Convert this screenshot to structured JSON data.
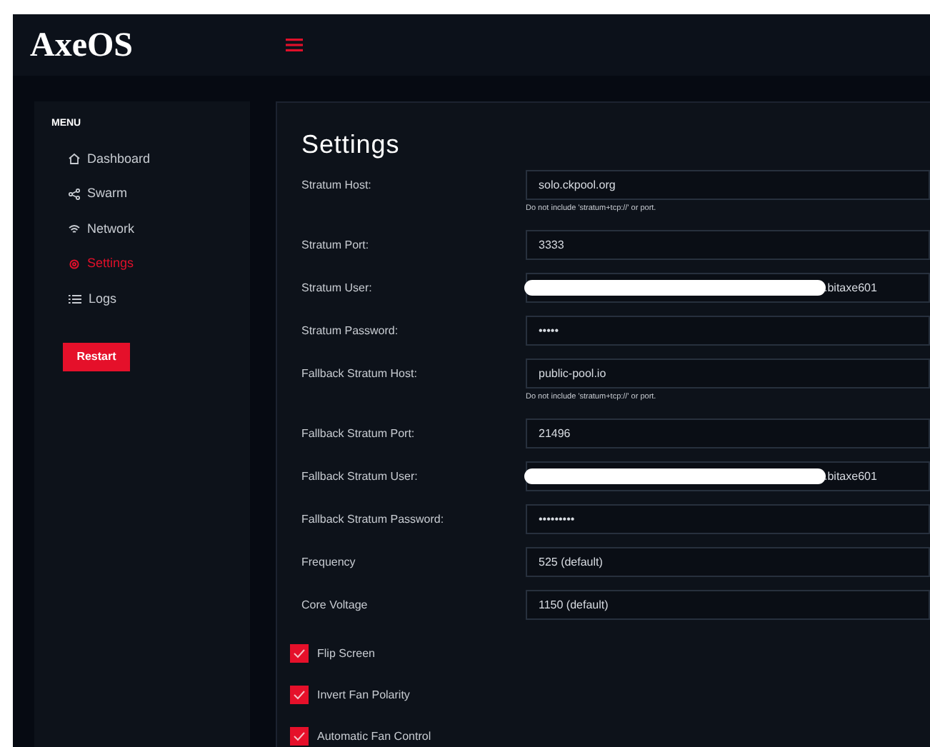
{
  "header": {
    "logo": "AxeOS"
  },
  "sidebar": {
    "heading": "MENU",
    "items": [
      {
        "label": "Dashboard",
        "selected": false
      },
      {
        "label": "Swarm",
        "selected": false
      },
      {
        "label": "Network",
        "selected": false
      },
      {
        "label": "Settings",
        "selected": true
      },
      {
        "label": "Logs",
        "selected": false
      }
    ],
    "restart_button": "Restart"
  },
  "settings": {
    "title": "Settings",
    "fields": [
      {
        "label": "Stratum Host:",
        "value": "solo.ckpool.org",
        "hint": "Do not include 'stratum+tcp://' or port.",
        "redacted": false
      },
      {
        "label": "Stratum Port:",
        "value": "3333",
        "redacted": false
      },
      {
        "label": "Stratum User:",
        "value": ".bitaxe601",
        "redacted": true
      },
      {
        "label": "Stratum Password:",
        "value": "•••••",
        "redacted": false
      },
      {
        "label": "Fallback Stratum Host:",
        "value": "public-pool.io",
        "hint": "Do not include 'stratum+tcp://' or port.",
        "redacted": false
      },
      {
        "label": "Fallback Stratum Port:",
        "value": "21496",
        "redacted": false
      },
      {
        "label": "Fallback Stratum User:",
        "value": ".bitaxe601",
        "redacted": true
      },
      {
        "label": "Fallback Stratum Password:",
        "value": "•••••••••",
        "redacted": false
      },
      {
        "label": "Frequency",
        "value": "525 (default)",
        "redacted": false
      },
      {
        "label": "Core Voltage",
        "value": "1150 (default)",
        "redacted": false
      }
    ],
    "checkboxes": [
      {
        "label": "Flip Screen",
        "checked": true
      },
      {
        "label": "Invert Fan Polarity",
        "checked": true
      },
      {
        "label": "Automatic Fan Control",
        "checked": true
      }
    ]
  }
}
